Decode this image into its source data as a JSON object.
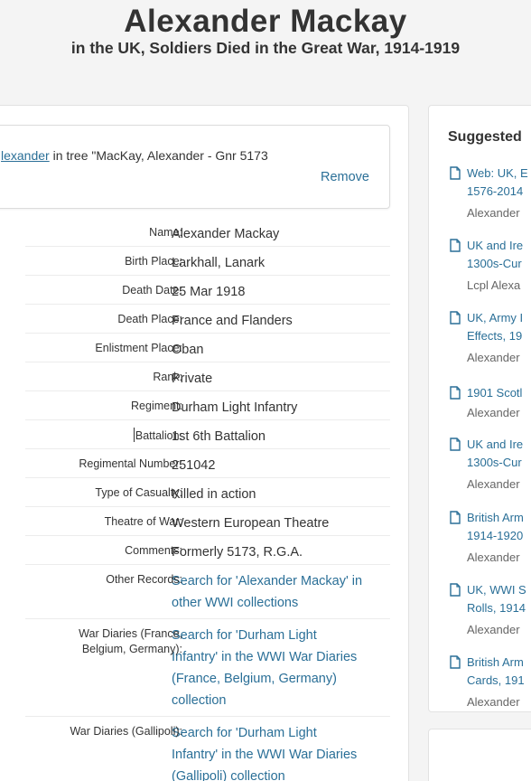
{
  "header": {
    "title": "Alexander Mackay",
    "subtitle": "in the UK, Soldiers Died in the Great War, 1914-1919"
  },
  "attach": {
    "link": "lexander",
    "text": " in tree \"MacKay, Alexander - Gnr 5173",
    "remove": "Remove"
  },
  "record": {
    "rows": [
      {
        "label": "Name:",
        "value": "Alexander Mackay"
      },
      {
        "label": "Birth Place:",
        "value": "Larkhall, Lanark"
      },
      {
        "label": "Death Date:",
        "value": "25 Mar 1918"
      },
      {
        "label": "Death Place:",
        "value": "France and Flanders"
      },
      {
        "label": "Enlistment Place:",
        "value": "Oban"
      },
      {
        "label": "Rank:",
        "value": "Private"
      },
      {
        "label": "Regiment:",
        "value": "Durham Light Infantry"
      },
      {
        "label": "Battalion:",
        "value": "1st 6th Battalion"
      },
      {
        "label": "Regimental Number:",
        "value": "251042"
      },
      {
        "label": "Type of Casualty:",
        "value": "Killed in action"
      },
      {
        "label": "Theatre of War:",
        "value": "Western European Theatre"
      },
      {
        "label": "Comments:",
        "value": "Formerly 5173, R.G.A."
      },
      {
        "label": "Other Records:",
        "value_lines": [
          "Search for 'Alexander Mackay' in",
          "other WWI collections"
        ]
      },
      {
        "label_lines": [
          "War Diaries (France,",
          "Belgium, Germany):"
        ],
        "value_lines": [
          "Search for 'Durham Light",
          "Infantry' in the WWI War Diaries",
          "(France, Belgium, Germany)",
          "collection"
        ]
      },
      {
        "label": "War Diaries (Gallipoli):",
        "value_lines": [
          "Search for 'Durham Light",
          "Infantry' in the WWI War Diaries",
          "(Gallipoli) collection"
        ]
      }
    ]
  },
  "suggested": {
    "title": "Suggested",
    "items": [
      {
        "lines": [
          "Web: UK, E",
          "1576-2014"
        ],
        "name": "Alexander"
      },
      {
        "lines": [
          "UK and Ire",
          "1300s-Cur"
        ],
        "name": "Lcpl Alexa"
      },
      {
        "lines": [
          "UK, Army I",
          "Effects, 19"
        ],
        "name": "Alexander"
      },
      {
        "lines": [
          "1901 Scotl"
        ],
        "name": "Alexander"
      },
      {
        "lines": [
          "UK and Ire",
          "1300s-Cur"
        ],
        "name": "Alexander"
      },
      {
        "lines": [
          "British Arm",
          "1914-1920"
        ],
        "name": "Alexander"
      },
      {
        "lines": [
          "UK, WWI S",
          "Rolls, 1914"
        ],
        "name": "Alexander"
      },
      {
        "lines": [
          "British Arm",
          "Cards, 191"
        ],
        "name": "Alexander"
      }
    ]
  },
  "colors": {
    "link": "#2a6f97",
    "text": "#333333",
    "background": "#f4f4f4"
  }
}
